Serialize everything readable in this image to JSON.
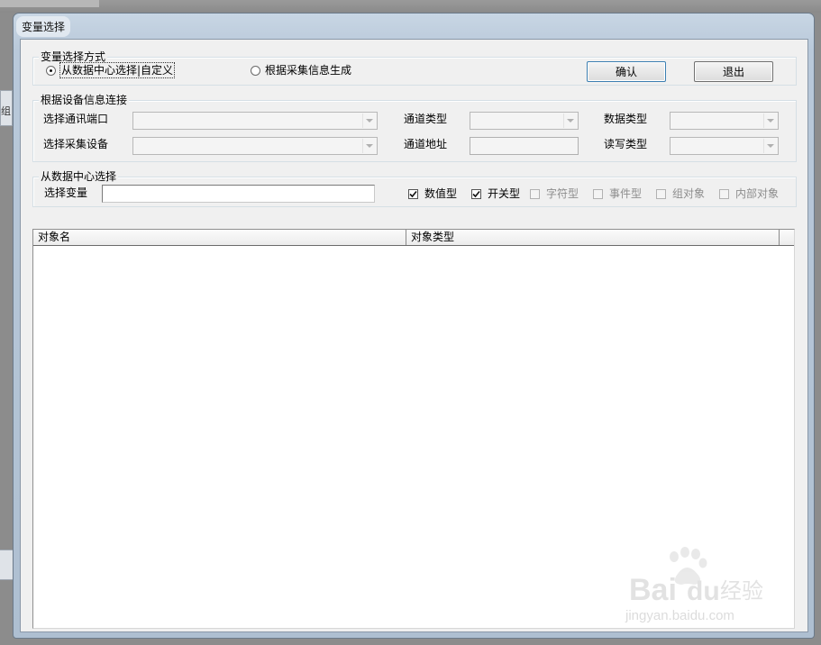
{
  "window": {
    "title": "变量选择"
  },
  "background": {
    "side_tab_text": "组"
  },
  "selection_mode": {
    "group_title": "变量选择方式",
    "options": [
      {
        "label": "从数据中心选择|自定义",
        "selected": true
      },
      {
        "label": "根据采集信息生成",
        "selected": false
      }
    ],
    "confirm_label": "确认",
    "exit_label": "退出"
  },
  "device_connection": {
    "group_title": "根据设备信息连接",
    "comm_port_label": "选择通讯端口",
    "collect_device_label": "选择采集设备",
    "channel_type_label": "通道类型",
    "channel_address_label": "通道地址",
    "data_type_label": "数据类型",
    "rw_type_label": "读写类型",
    "comm_port_value": "",
    "collect_device_value": "",
    "channel_type_value": "",
    "channel_address_value": "",
    "data_type_value": "",
    "rw_type_value": ""
  },
  "data_center": {
    "group_title": "从数据中心选择",
    "variable_label": "选择变量",
    "variable_value": "",
    "filters": [
      {
        "label": "数值型",
        "checked": true,
        "enabled": true
      },
      {
        "label": "开关型",
        "checked": true,
        "enabled": true
      },
      {
        "label": "字符型",
        "checked": false,
        "enabled": false
      },
      {
        "label": "事件型",
        "checked": false,
        "enabled": false
      },
      {
        "label": "组对象",
        "checked": false,
        "enabled": false
      },
      {
        "label": "内部对象",
        "checked": false,
        "enabled": false
      }
    ]
  },
  "object_list": {
    "columns": [
      "对象名",
      "对象类型"
    ],
    "rows": []
  },
  "watermark": {
    "brand_a": "Bai",
    "brand_b": "du",
    "brand_cn": "经验",
    "url": "jingyan.baidu.com"
  }
}
